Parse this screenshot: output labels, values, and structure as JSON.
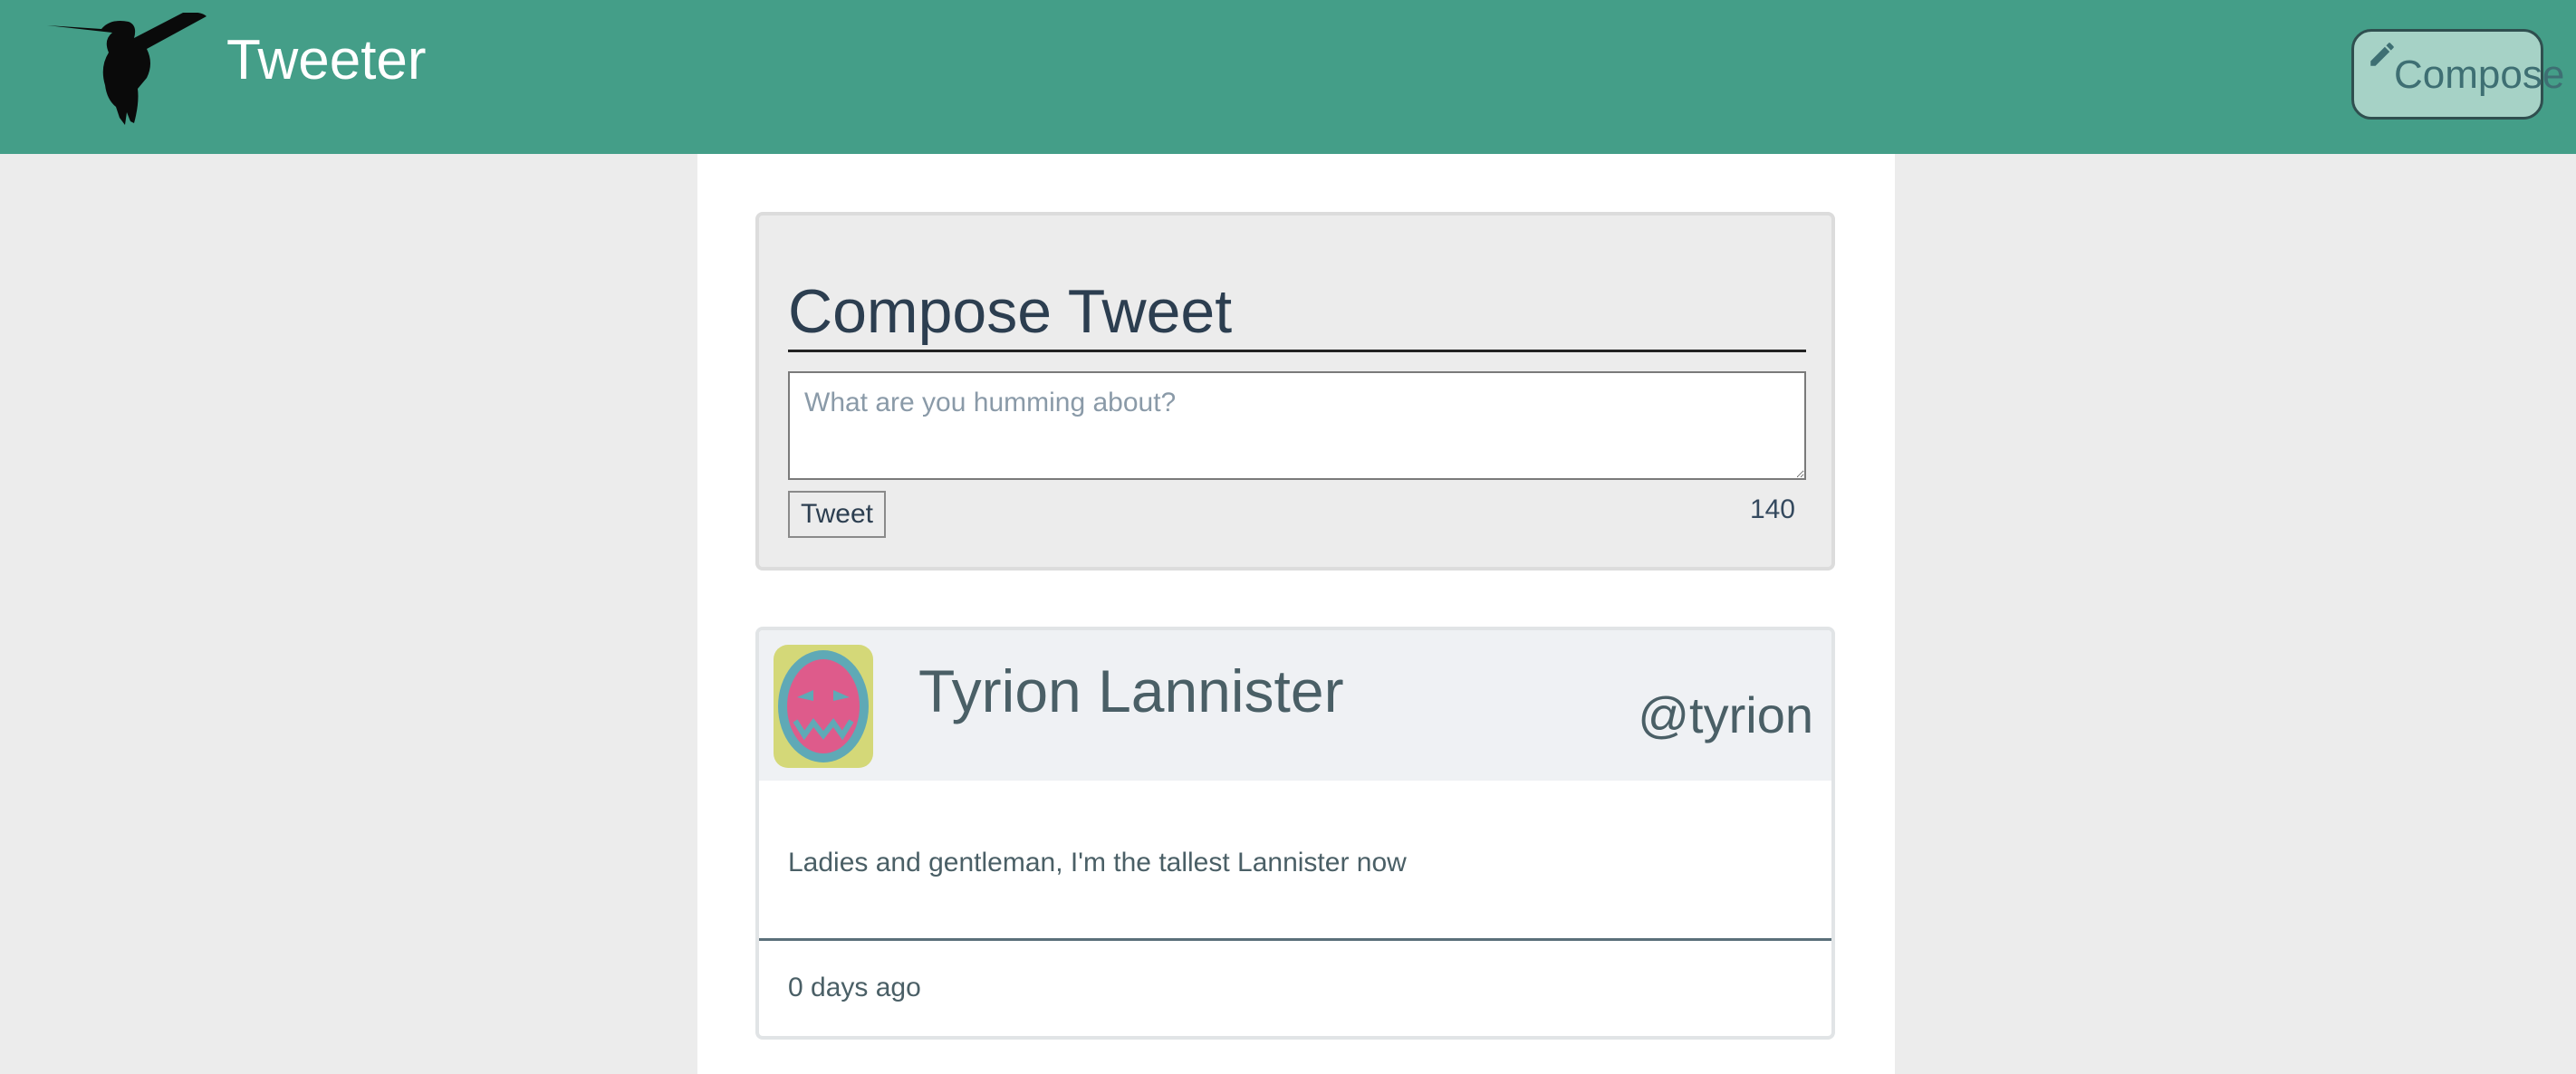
{
  "app": {
    "title": "Tweeter"
  },
  "nav": {
    "compose_label": "Compose"
  },
  "compose": {
    "title": "Compose Tweet",
    "placeholder": "What are you humming about?",
    "value": "",
    "button_label": "Tweet",
    "char_count": "140"
  },
  "tweets": [
    {
      "name": "Tyrion Lannister",
      "handle": "@tyrion",
      "text": "Ladies and gentleman, I'm the tallest Lannister now",
      "timestamp": "0 days ago"
    }
  ],
  "icons": {
    "logo": "hummingbird-icon",
    "compose": "pencil-icon",
    "avatar": "face-avatar"
  },
  "colors": {
    "nav_bg": "#449e88",
    "page_bg": "#ececec",
    "compose_button_bg": "#a6d2c6",
    "avatar_bg": "#d4d878",
    "avatar_face": "#de5b8b"
  }
}
